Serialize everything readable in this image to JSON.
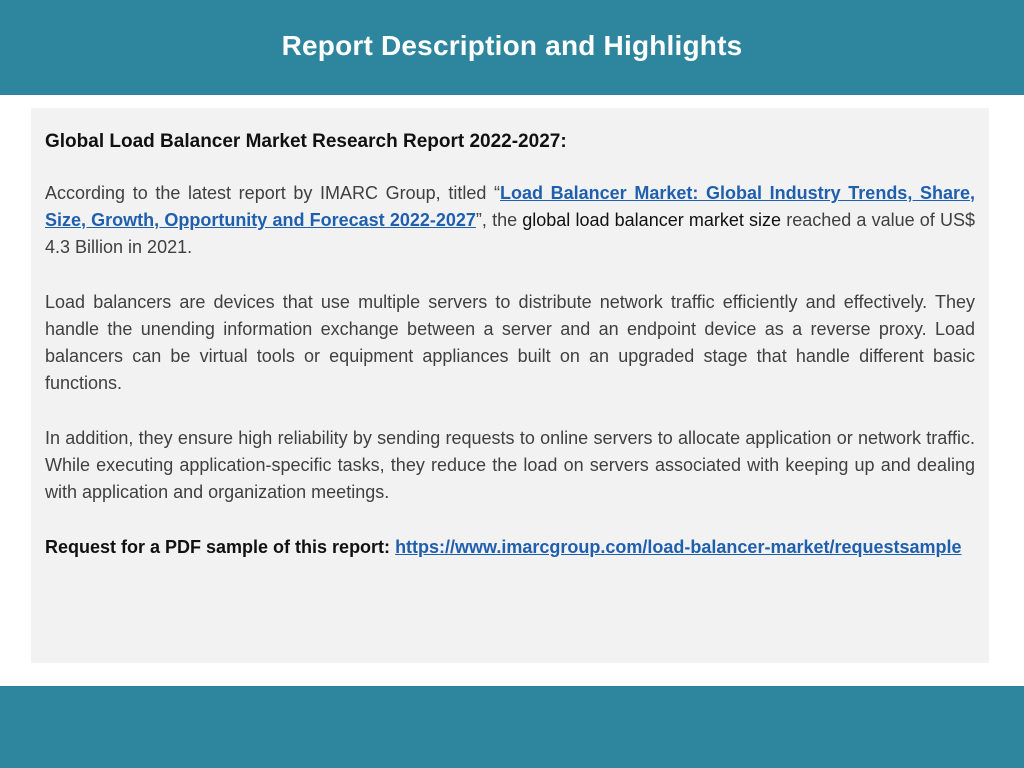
{
  "header": {
    "title": "Report Description and Highlights"
  },
  "content": {
    "heading": "Global Load Balancer Market Research Report 2022-2027:",
    "p1": {
      "before_link": "According to the latest report by IMARC Group, titled “",
      "link_text": "Load Balancer Market: Global Industry Trends, Share, Size, Growth, Opportunity and Forecast 2022-2027",
      "after_link": "”, the ",
      "dark_text": "global load balancer market size",
      "end": " reached a value of US$ 4.3 Billion in 2021."
    },
    "p2": "Load balancers are devices that use multiple servers to distribute network traffic efficiently and effectively. They handle the unending information exchange between a server and an endpoint device as a reverse proxy. Load balancers can be virtual tools or equipment appliances built on an upgraded stage that handle different basic functions.",
    "p3": "In addition, they ensure high reliability by sending requests to online servers to allocate application or network traffic. While executing application-specific tasks, they reduce the load on servers associated with keeping up and dealing with application and organization meetings.",
    "request": {
      "label": "Request for a PDF sample of this report: ",
      "url": "https://www.imarcgroup.com/load-balancer-market/requestsample"
    }
  },
  "colors": {
    "band": "#2e869e",
    "panel": "#f2f2f2",
    "link": "#1f5fae"
  }
}
